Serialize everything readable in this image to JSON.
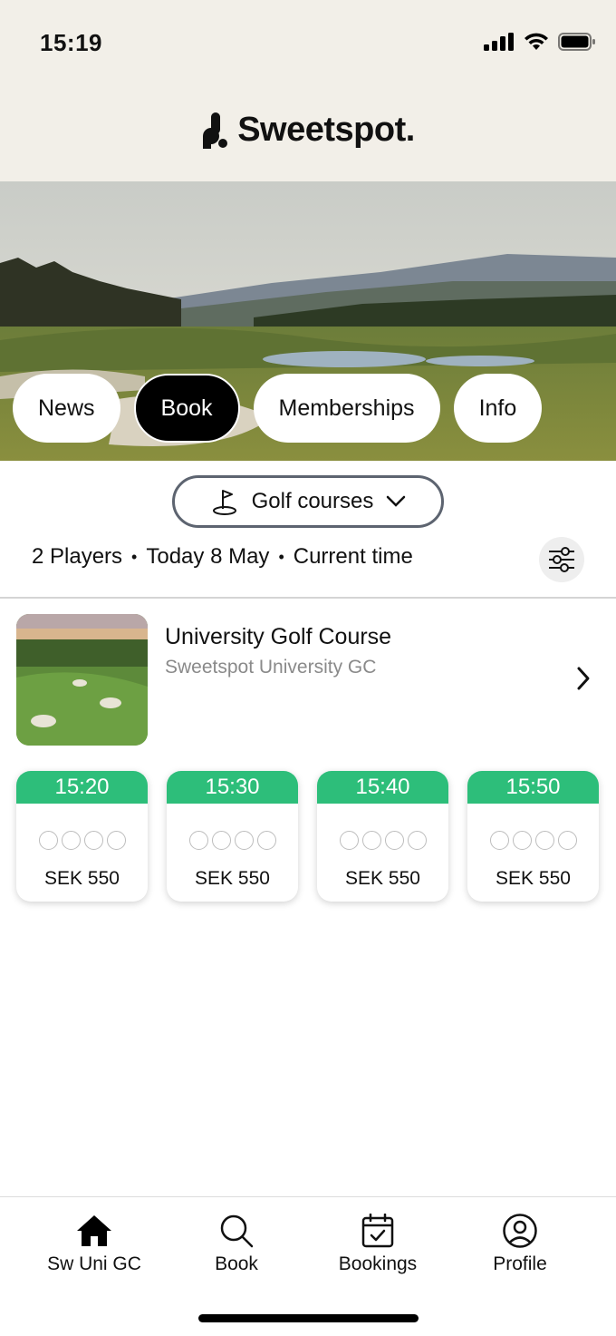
{
  "status_bar": {
    "time": "15:19"
  },
  "header": {
    "brand": "Sweetspot."
  },
  "hero_tabs": [
    {
      "label": "News",
      "active": false
    },
    {
      "label": "Book",
      "active": true
    },
    {
      "label": "Memberships",
      "active": false
    },
    {
      "label": "Info",
      "active": false
    }
  ],
  "filters": {
    "course_select": "Golf courses",
    "players": "2 Players",
    "date": "Today 8 May",
    "time": "Current time",
    "separator": "•"
  },
  "course": {
    "name": "University Golf Course",
    "club": "Sweetspot University GC"
  },
  "slots": [
    {
      "time": "15:20",
      "price": "SEK 550",
      "spots_total": 4,
      "spots_taken": 0
    },
    {
      "time": "15:30",
      "price": "SEK 550",
      "spots_total": 4,
      "spots_taken": 0
    },
    {
      "time": "15:40",
      "price": "SEK 550",
      "spots_total": 4,
      "spots_taken": 0
    },
    {
      "time": "15:50",
      "price": "SEK 550",
      "spots_total": 4,
      "spots_taken": 0
    }
  ],
  "tabbar": [
    {
      "label": "Sw Uni GC",
      "icon": "home-icon"
    },
    {
      "label": "Book",
      "icon": "search-icon"
    },
    {
      "label": "Bookings",
      "icon": "calendar-check-icon"
    },
    {
      "label": "Profile",
      "icon": "user-circle-icon"
    }
  ],
  "colors": {
    "accent": "#2dbe7a",
    "header_bg": "#f2efe8",
    "active_pill": "#000000"
  }
}
